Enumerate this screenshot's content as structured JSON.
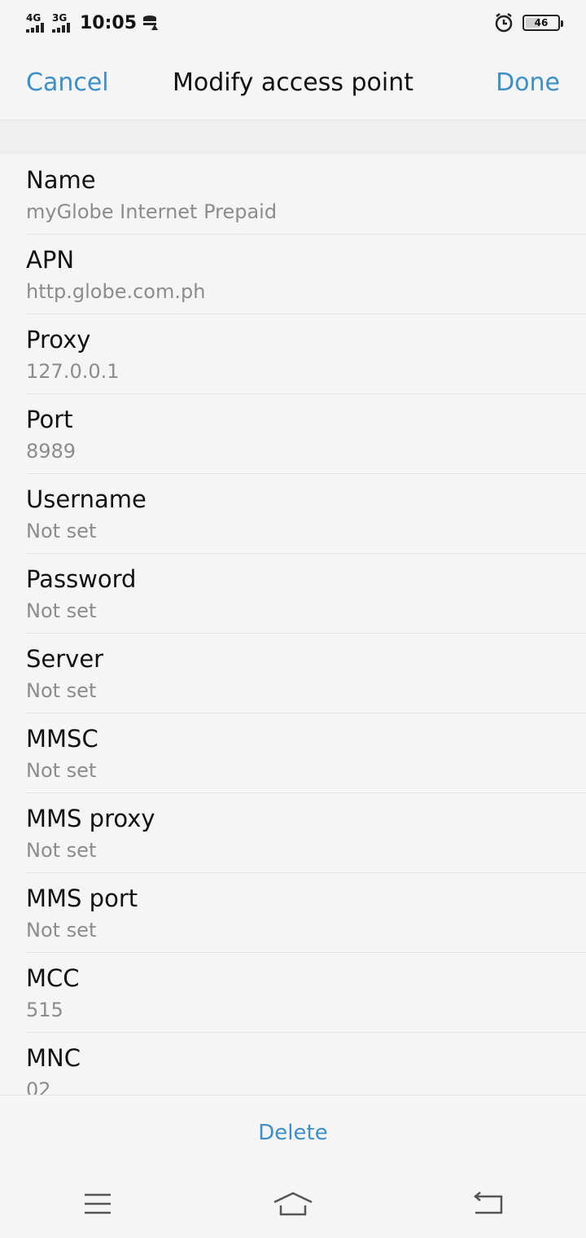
{
  "status_bar": {
    "network_1": "4G",
    "network_2": "3G",
    "time": "10:05",
    "battery": "46",
    "battery_level": 0.46,
    "icons": [
      "signal-icon",
      "data-transfer-icon",
      "alarm-icon",
      "battery-icon"
    ]
  },
  "header": {
    "cancel_label": "Cancel",
    "title": "Modify access point",
    "done_label": "Done"
  },
  "fields": [
    {
      "label": "Name",
      "value": "myGlobe Internet Prepaid"
    },
    {
      "label": "APN",
      "value": "http.globe.com.ph"
    },
    {
      "label": "Proxy",
      "value": "127.0.0.1"
    },
    {
      "label": "Port",
      "value": "8989"
    },
    {
      "label": "Username",
      "value": "Not set"
    },
    {
      "label": "Password",
      "value": "Not set"
    },
    {
      "label": "Server",
      "value": "Not set"
    },
    {
      "label": "MMSC",
      "value": "Not set"
    },
    {
      "label": "MMS proxy",
      "value": "Not set"
    },
    {
      "label": "MMS port",
      "value": "Not set"
    },
    {
      "label": "MCC",
      "value": "515"
    },
    {
      "label": "MNC",
      "value": "02"
    }
  ],
  "footer": {
    "delete_label": "Delete"
  },
  "nav": {
    "icons": [
      "menu-icon",
      "home-icon",
      "back-icon"
    ]
  },
  "colors": {
    "accent": "#3d8fc7",
    "background": "#f5f5f5",
    "value_text": "#8c8c8c"
  }
}
